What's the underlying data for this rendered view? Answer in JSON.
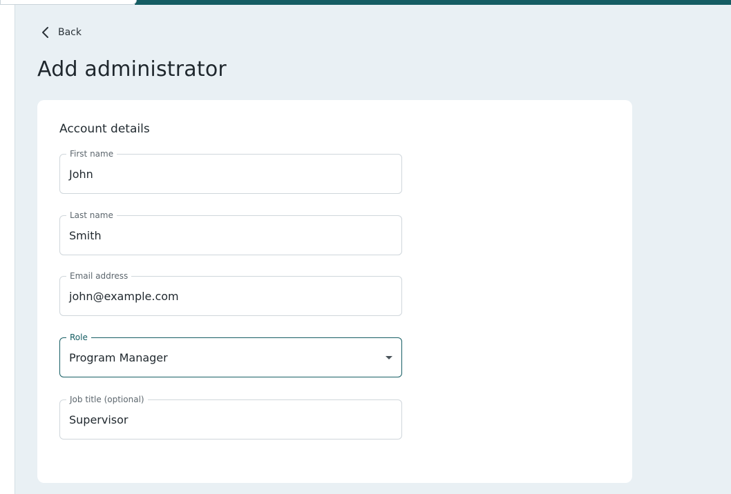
{
  "nav": {
    "back_label": "Back"
  },
  "page": {
    "title": "Add administrator"
  },
  "card": {
    "section_title": "Account details",
    "fields": [
      {
        "label": "First name",
        "value": "John"
      },
      {
        "label": "Last name",
        "value": "Smith"
      },
      {
        "label": "Email address",
        "value": "john@example.com"
      },
      {
        "label": "Role",
        "value": "Program Manager"
      },
      {
        "label": "Job title (optional)",
        "value": "Supervisor"
      }
    ]
  },
  "colors": {
    "accent": "#155d63",
    "background": "#e9f0f4"
  },
  "icons": {
    "back": "chevron-left-icon",
    "role_dropdown": "caret-down-icon"
  }
}
